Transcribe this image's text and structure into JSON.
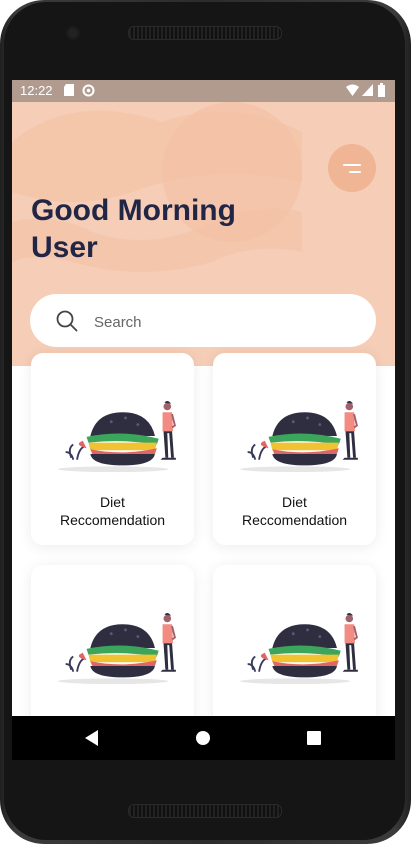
{
  "status_bar": {
    "time": "12:22"
  },
  "header": {
    "greeting_line1": "Good Morning",
    "greeting_line2": "User"
  },
  "search": {
    "placeholder": "Search"
  },
  "cards": [
    {
      "title_line1": "Diet",
      "title_line2": "Reccomendation"
    },
    {
      "title_line1": "Diet",
      "title_line2": "Reccomendation"
    },
    {
      "title_line1": "",
      "title_line2": ""
    },
    {
      "title_line1": "",
      "title_line2": ""
    }
  ],
  "colors": {
    "hero_bg": "#f6cdb6",
    "heading": "#222646",
    "menu_button": "#f0b595"
  },
  "icons": [
    "sd-card-icon",
    "data-saver-icon",
    "wifi-icon",
    "signal-icon",
    "battery-icon",
    "menu-icon",
    "search-icon",
    "back-icon",
    "home-icon",
    "recents-icon"
  ]
}
